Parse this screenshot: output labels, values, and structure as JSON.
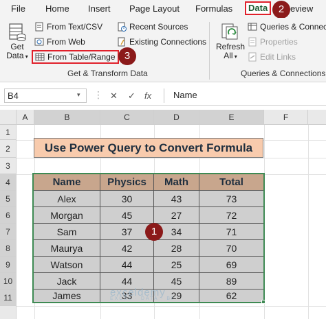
{
  "ribbon_tabs": [
    {
      "label": "File"
    },
    {
      "label": "Home"
    },
    {
      "label": "Insert"
    },
    {
      "label": "Page Layout"
    },
    {
      "label": "Formulas"
    },
    {
      "label": "Data"
    },
    {
      "label": "eview"
    }
  ],
  "ribbon": {
    "get_data_label_1": "Get",
    "get_data_label_2": "Data",
    "from_text_csv": "From Text/CSV",
    "from_web": "From Web",
    "from_table_range": "From Table/Range",
    "recent_sources": "Recent Sources",
    "existing_connections": "Existing Connections",
    "group_get_transform": "Get & Transform Data",
    "refresh_all_1": "Refresh",
    "refresh_all_2": "All",
    "queries_connections": "Queries & Connect",
    "properties": "Properties",
    "edit_links": "Edit Links",
    "group_queries": "Queries & Connections"
  },
  "badges": {
    "one": "1",
    "two": "2",
    "three": "3"
  },
  "formula_bar": {
    "name_box": "B4",
    "cancel": "✕",
    "enter": "✓",
    "fx": "fx",
    "content": "Name"
  },
  "sheet": {
    "columns": [
      "A",
      "B",
      "C",
      "D",
      "E",
      "F"
    ],
    "rows": [
      "1",
      "2",
      "3",
      "4",
      "5",
      "6",
      "7",
      "8",
      "9",
      "10",
      "11"
    ],
    "title": "Use Power Query to Convert Formula",
    "table": {
      "headers": [
        "Name",
        "Physics",
        "Math",
        "Total"
      ],
      "rows": [
        [
          "Alex",
          "30",
          "43",
          "73"
        ],
        [
          "Morgan",
          "45",
          "27",
          "72"
        ],
        [
          "Sam",
          "37",
          "34",
          "71"
        ],
        [
          "Maurya",
          "42",
          "28",
          "70"
        ],
        [
          "Watson",
          "44",
          "25",
          "69"
        ],
        [
          "Jack",
          "44",
          "45",
          "89"
        ],
        [
          "James",
          "33",
          "29",
          "62"
        ]
      ]
    }
  },
  "watermark": {
    "brand": "exceldemy",
    "tagline": "EXCEL · DATA · BI"
  },
  "colors": {
    "accent_green": "#3e8a53",
    "highlight_red": "#e0202a",
    "badge": "#8b1a1a",
    "title_fill": "#f8cbad",
    "header_fill": "#c8a68d",
    "body_fill": "#cfcfcf"
  }
}
